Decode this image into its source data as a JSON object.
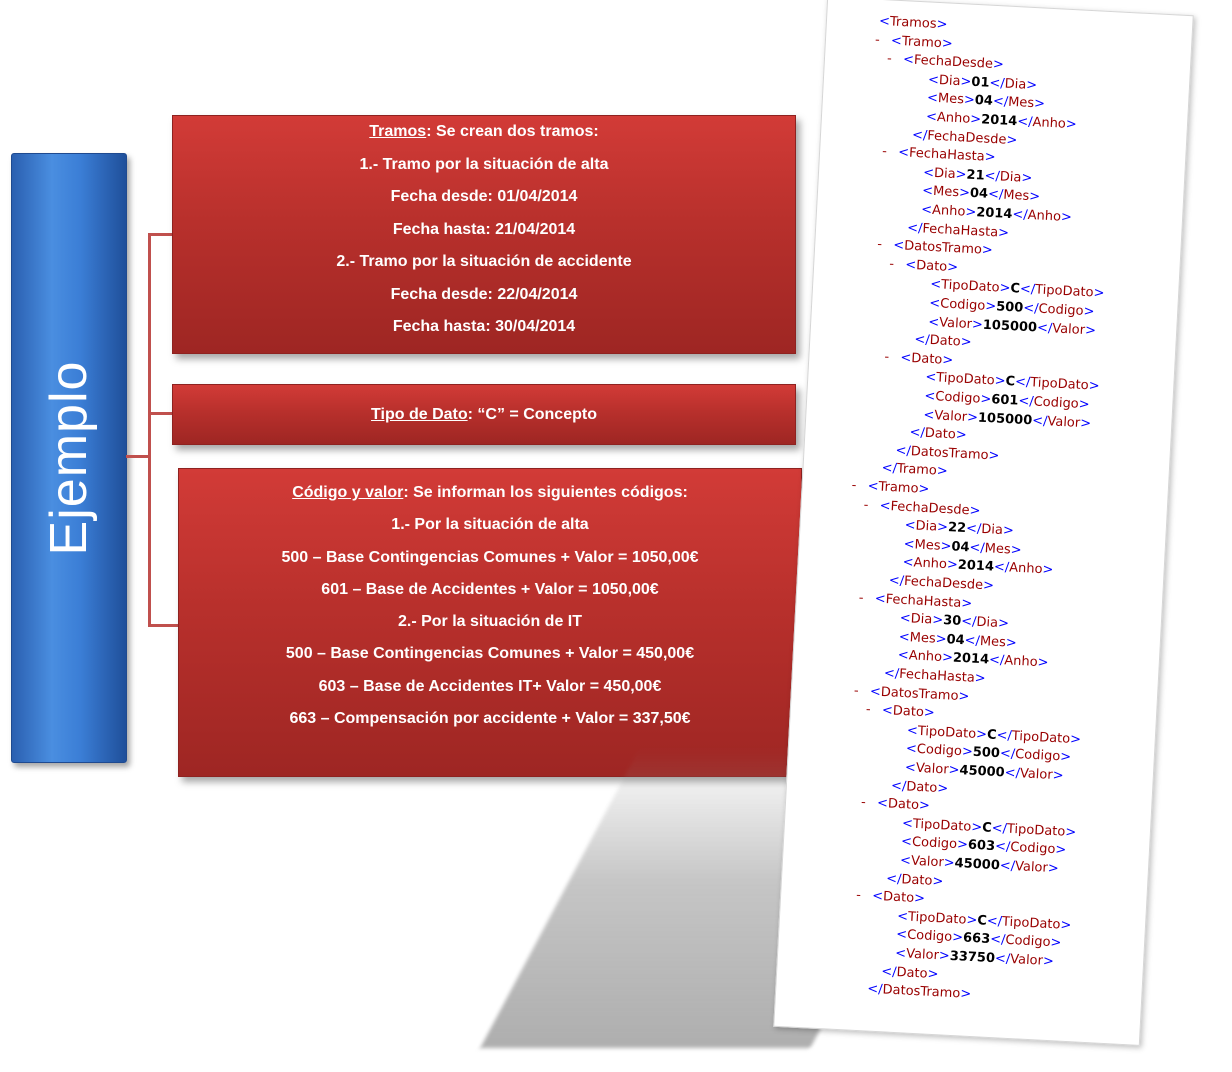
{
  "side_title": "Ejemplo",
  "box_tramos": {
    "heading": "Tramos",
    "heading_rest": ": Se crean dos tramos:",
    "lines": [
      "1.- Tramo por la situación de alta",
      "Fecha desde: 01/04/2014",
      "Fecha hasta: 21/04/2014",
      "2.- Tramo por la situación de accidente",
      "Fecha desde: 22/04/2014",
      "Fecha hasta: 30/04/2014"
    ]
  },
  "box_tipo": {
    "heading": "Tipo de Dato",
    "heading_rest": ": “C” = Concepto"
  },
  "box_codigo": {
    "heading": "Código y valor",
    "heading_rest": ": Se informan los siguientes códigos:",
    "lines": [
      "1.- Por la situación de alta",
      "500 – Base Contingencias Comunes + Valor = 1050,00€",
      "601 – Base de Accidentes + Valor = 1050,00€",
      "2.- Por la situación de IT",
      "500 – Base Contingencias Comunes + Valor = 450,00€",
      "603 – Base de Accidentes  IT+ Valor = 450,00€",
      "663 – Compensación  por accidente + Valor = 337,50€"
    ]
  },
  "xml": [
    {
      "indent": 0,
      "minus": false,
      "open": "<",
      "tag": "Tramos",
      "close": ">"
    },
    {
      "indent": 1,
      "minus": true,
      "open": "<",
      "tag": "Tramo",
      "close": ">"
    },
    {
      "indent": 2,
      "minus": true,
      "open": "<",
      "tag": "FechaDesde",
      "close": ">"
    },
    {
      "indent": 4,
      "elem": "Dia",
      "value": "01"
    },
    {
      "indent": 4,
      "elem": "Mes",
      "value": "04"
    },
    {
      "indent": 4,
      "elem": "Anho",
      "value": "2014"
    },
    {
      "indent": 3,
      "minus": false,
      "open": "</",
      "tag": "FechaDesde",
      "close": ">"
    },
    {
      "indent": 2,
      "minus": true,
      "open": "<",
      "tag": "FechaHasta",
      "close": ">"
    },
    {
      "indent": 4,
      "elem": "Dia",
      "value": "21"
    },
    {
      "indent": 4,
      "elem": "Mes",
      "value": "04"
    },
    {
      "indent": 4,
      "elem": "Anho",
      "value": "2014"
    },
    {
      "indent": 3,
      "minus": false,
      "open": "</",
      "tag": "FechaHasta",
      "close": ">"
    },
    {
      "indent": 2,
      "minus": true,
      "open": "<",
      "tag": "DatosTramo",
      "close": ">"
    },
    {
      "indent": 3,
      "minus": true,
      "open": "<",
      "tag": "Dato",
      "close": ">"
    },
    {
      "indent": 5,
      "elem": "TipoDato",
      "value": "C"
    },
    {
      "indent": 5,
      "elem": "Codigo",
      "value": "500"
    },
    {
      "indent": 5,
      "elem": "Valor",
      "value": "105000"
    },
    {
      "indent": 4,
      "minus": false,
      "open": "</",
      "tag": "Dato",
      "close": ">"
    },
    {
      "indent": 3,
      "minus": true,
      "open": "<",
      "tag": "Dato",
      "close": ">"
    },
    {
      "indent": 5,
      "elem": "TipoDato",
      "value": "C"
    },
    {
      "indent": 5,
      "elem": "Codigo",
      "value": "601"
    },
    {
      "indent": 5,
      "elem": "Valor",
      "value": "105000"
    },
    {
      "indent": 4,
      "minus": false,
      "open": "</",
      "tag": "Dato",
      "close": ">"
    },
    {
      "indent": 3,
      "minus": false,
      "open": "</",
      "tag": "DatosTramo",
      "close": ">"
    },
    {
      "indent": 2,
      "minus": false,
      "open": "</",
      "tag": "Tramo",
      "close": ">"
    },
    {
      "indent": 1,
      "minus": true,
      "open": "<",
      "tag": "Tramo",
      "close": ">"
    },
    {
      "indent": 2,
      "minus": true,
      "open": "<",
      "tag": "FechaDesde",
      "close": ">"
    },
    {
      "indent": 4,
      "elem": "Dia",
      "value": "22"
    },
    {
      "indent": 4,
      "elem": "Mes",
      "value": "04"
    },
    {
      "indent": 4,
      "elem": "Anho",
      "value": "2014"
    },
    {
      "indent": 3,
      "minus": false,
      "open": "</",
      "tag": "FechaDesde",
      "close": ">"
    },
    {
      "indent": 2,
      "minus": true,
      "open": "<",
      "tag": "FechaHasta",
      "close": ">"
    },
    {
      "indent": 4,
      "elem": "Dia",
      "value": "30"
    },
    {
      "indent": 4,
      "elem": "Mes",
      "value": "04"
    },
    {
      "indent": 4,
      "elem": "Anho",
      "value": "2014"
    },
    {
      "indent": 3,
      "minus": false,
      "open": "</",
      "tag": "FechaHasta",
      "close": ">"
    },
    {
      "indent": 2,
      "minus": true,
      "open": "<",
      "tag": "DatosTramo",
      "close": ">"
    },
    {
      "indent": 3,
      "minus": true,
      "open": "<",
      "tag": "Dato",
      "close": ">"
    },
    {
      "indent": 5,
      "elem": "TipoDato",
      "value": "C"
    },
    {
      "indent": 5,
      "elem": "Codigo",
      "value": "500"
    },
    {
      "indent": 5,
      "elem": "Valor",
      "value": "45000"
    },
    {
      "indent": 4,
      "minus": false,
      "open": "</",
      "tag": "Dato",
      "close": ">"
    },
    {
      "indent": 3,
      "minus": true,
      "open": "<",
      "tag": "Dato",
      "close": ">"
    },
    {
      "indent": 5,
      "elem": "TipoDato",
      "value": "C"
    },
    {
      "indent": 5,
      "elem": "Codigo",
      "value": "603"
    },
    {
      "indent": 5,
      "elem": "Valor",
      "value": "45000"
    },
    {
      "indent": 4,
      "minus": false,
      "open": "</",
      "tag": "Dato",
      "close": ">"
    },
    {
      "indent": 3,
      "minus": true,
      "open": "<",
      "tag": "Dato",
      "close": ">"
    },
    {
      "indent": 5,
      "elem": "TipoDato",
      "value": "C"
    },
    {
      "indent": 5,
      "elem": "Codigo",
      "value": "663"
    },
    {
      "indent": 5,
      "elem": "Valor",
      "value": "33750"
    },
    {
      "indent": 4,
      "minus": false,
      "open": "</",
      "tag": "Dato",
      "close": ">"
    },
    {
      "indent": 3,
      "minus": false,
      "open": "</",
      "tag": "DatosTramo",
      "close": ">"
    }
  ],
  "colors": {
    "box_red": "#b8302c",
    "title_blue": "#3b7ed6",
    "connector": "#c0504d",
    "xml_markup": "#0000ff",
    "xml_tag": "#990000"
  }
}
